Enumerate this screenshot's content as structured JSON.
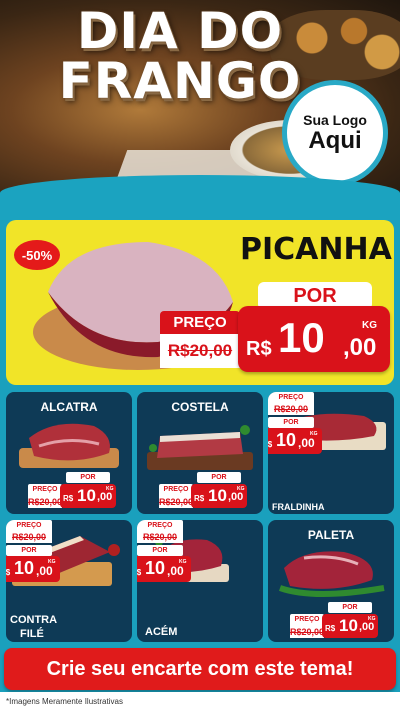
{
  "header": {
    "title_line1": "DIA DO",
    "title_line2": "FRANGO",
    "logo_line1": "Sua Logo",
    "logo_line2": "Aqui"
  },
  "featured": {
    "name": "PICANHA",
    "discount_badge": "-50%",
    "por_label": "POR",
    "preco_label": "PREÇO",
    "old_price": "R$20,00",
    "currency": "R$",
    "price_int": "10",
    "price_dec": ",00",
    "unit": "KG"
  },
  "products": [
    {
      "name": "ALCATRA",
      "preco_label": "PREÇO",
      "old_price": "R$20,00",
      "por_label": "POR",
      "currency": "R$",
      "price_int": "10",
      "price_dec": ",00",
      "unit": "KG"
    },
    {
      "name": "COSTELA",
      "preco_label": "PREÇO",
      "old_price": "R$20,00",
      "por_label": "POR",
      "currency": "R$",
      "price_int": "10",
      "price_dec": ",00",
      "unit": "KG"
    },
    {
      "name": "FRALDINHA",
      "preco_label": "PREÇO",
      "old_price": "R$20,00",
      "por_label": "POR",
      "currency": "R$",
      "price_int": "10",
      "price_dec": ",00",
      "unit": "KG"
    },
    {
      "name_line1": "CONTRA",
      "name_line2": "FILÉ",
      "preco_label": "PREÇO",
      "old_price": "R$20,00",
      "por_label": "POR",
      "currency": "R$",
      "price_int": "10",
      "price_dec": ",00",
      "unit": "KG"
    },
    {
      "name": "ACÉM",
      "preco_label": "PREÇO",
      "old_price": "R$20,00",
      "por_label": "POR",
      "currency": "R$",
      "price_int": "10",
      "price_dec": ",00",
      "unit": "KG"
    },
    {
      "name": "PALETA",
      "preco_label": "PREÇO",
      "old_price": "R$20,00",
      "por_label": "POR",
      "currency": "R$",
      "price_int": "10",
      "price_dec": ",00",
      "unit": "KG"
    }
  ],
  "cta": "Crie seu encarte com este tema!",
  "footer_note": "*Imagens Meramente Ilustrativas",
  "colors": {
    "accent_red": "#d9121a",
    "feature_yellow": "#f1e428",
    "background_teal": "#1aa0bd",
    "card_navy": "#0e3a56"
  }
}
